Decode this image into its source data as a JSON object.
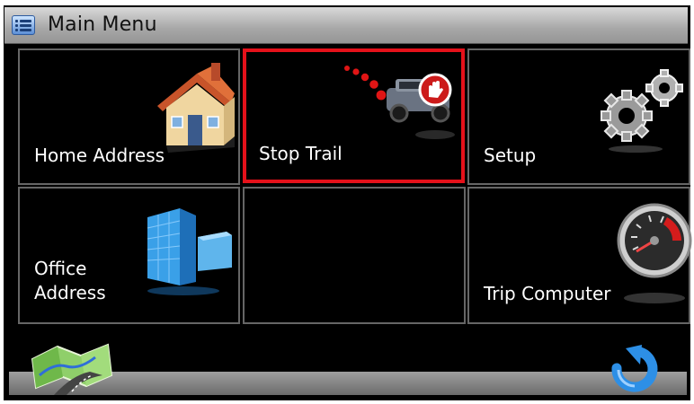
{
  "header": {
    "title": "Main Menu",
    "icon": "menu-list-icon"
  },
  "tiles": [
    {
      "label": "Home Address",
      "icon": "house-icon",
      "selected": false
    },
    {
      "label": "Stop Trail",
      "icon": "stop-trail-icon",
      "selected": true
    },
    {
      "label": "Setup",
      "icon": "gears-icon",
      "selected": false
    },
    {
      "label": "Office\nAddress",
      "icon": "office-building-icon",
      "selected": false
    },
    {
      "label": "",
      "icon": "",
      "selected": false
    },
    {
      "label": "Trip Computer",
      "icon": "speedometer-icon",
      "selected": false
    }
  ],
  "footer": {
    "left_button_icon": "map-icon",
    "right_button_icon": "back-arrow-icon"
  },
  "colors": {
    "selection_border": "#e5111a",
    "tile_background": "#000000",
    "tile_border": "#666666",
    "title_bar": "#b0b0b0"
  }
}
